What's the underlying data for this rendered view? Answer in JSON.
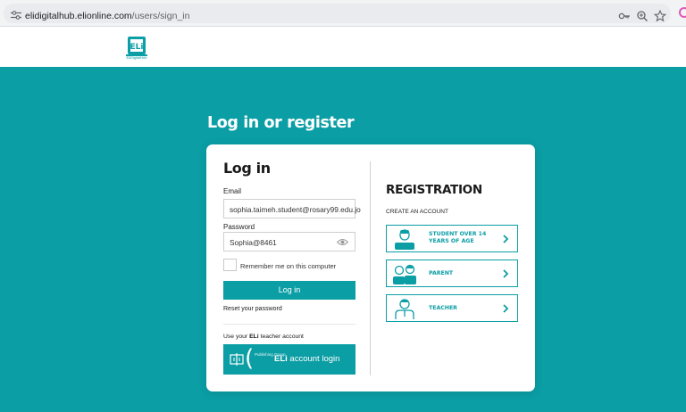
{
  "browser": {
    "url_host": "elidigitalhub.elionline.com",
    "url_path": "/users/sign_in",
    "icons": [
      "tune-icon",
      "key-icon",
      "zoom-icon",
      "star-icon",
      "extension-icon"
    ]
  },
  "header": {
    "logo_text": "EliDigitalHub"
  },
  "page": {
    "title": "Log in or register"
  },
  "login": {
    "title": "Log in",
    "email_label": "Email",
    "email_value": "sophia.taimeh.student@rosary99.edu.jo",
    "password_label": "Password",
    "password_value": "Sophia@8461",
    "remember_label": "Remember me on this computer",
    "submit_label": "Log in",
    "reset_label": "Reset your password",
    "teacher_note_prefix": "Use your ",
    "teacher_note_brand": "ELi",
    "teacher_note_suffix": " teacher account",
    "eli_button_small": "Publishing Group",
    "eli_button_brand": "ELi",
    "eli_button_text": " account login"
  },
  "registration": {
    "title": "REGISTRATION",
    "subtitle": "CREATE AN ACCOUNT",
    "options": [
      {
        "label_line1": "STUDENT OVER 14",
        "label_line2": "YEARS OF AGE",
        "icon": "student-icon"
      },
      {
        "label_line1": "PARENT",
        "label_line2": "",
        "icon": "parent-icon"
      },
      {
        "label_line1": "TEACHER",
        "label_line2": "",
        "icon": "teacher-icon"
      }
    ]
  },
  "colors": {
    "accent": "#0b9ea5",
    "card": "#ffffff",
    "text": "#1a1a1a"
  }
}
